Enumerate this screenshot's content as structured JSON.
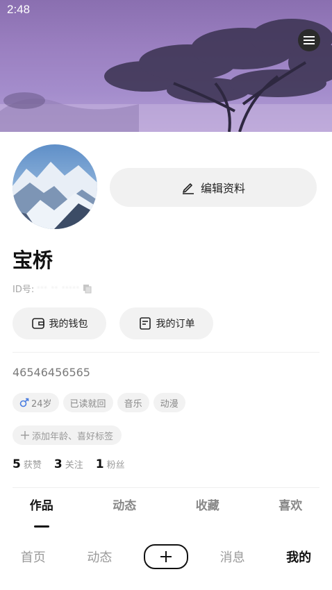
{
  "status_bar": {
    "time": "2:48"
  },
  "profile": {
    "edit_label": "编辑资料",
    "name": "宝桥",
    "id_prefix": "ID号:",
    "id_value": "··· ·· ·····",
    "wallet_label": "我的钱包",
    "orders_label": "我的订单",
    "bio": "46546456565",
    "tags": [
      {
        "label": "24岁",
        "icon": "male-icon"
      },
      {
        "label": "已读就回"
      },
      {
        "label": "音乐"
      },
      {
        "label": "动漫"
      }
    ],
    "add_tag_label": "添加年龄、喜好标签",
    "stats": [
      {
        "num": "5",
        "label": "获赞"
      },
      {
        "num": "3",
        "label": "关注"
      },
      {
        "num": "1",
        "label": "粉丝"
      }
    ]
  },
  "tabs": [
    {
      "label": "作品",
      "active": true
    },
    {
      "label": "动态"
    },
    {
      "label": "收藏"
    },
    {
      "label": "喜欢"
    }
  ],
  "bottom_nav": {
    "home": "首页",
    "feed": "动态",
    "messages": "消息",
    "mine": "我的"
  },
  "colors": {
    "accent": "#111111",
    "banner": "#9a7fc0",
    "male_icon": "#4a7de0"
  }
}
